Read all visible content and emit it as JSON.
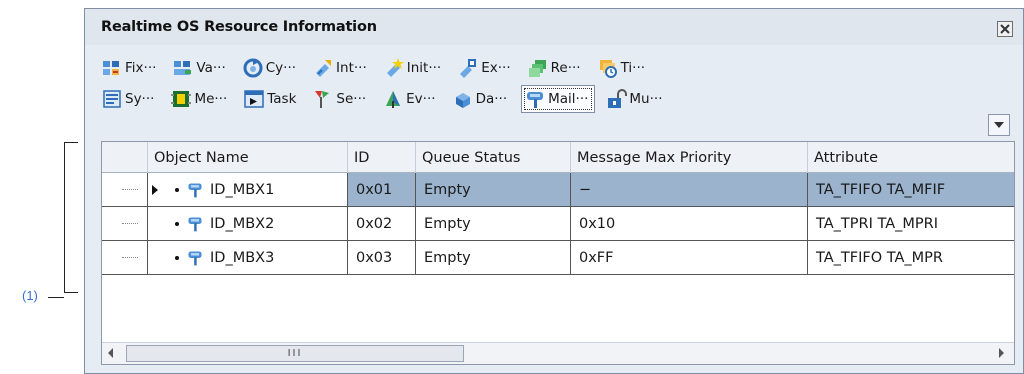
{
  "annotation": {
    "label": "(1)"
  },
  "window": {
    "title": "Realtime OS Resource Information"
  },
  "toolbar": {
    "row1": [
      {
        "label": "Fix···",
        "icon": "fixed-memory-icon"
      },
      {
        "label": "Va···",
        "icon": "variable-memory-icon"
      },
      {
        "label": "Cy···",
        "icon": "cyclic-handler-icon"
      },
      {
        "label": "Int···",
        "icon": "interrupt-handler-icon"
      },
      {
        "label": "Init···",
        "icon": "initialize-routine-icon"
      },
      {
        "label": "Ex···",
        "icon": "extended-svc-icon"
      },
      {
        "label": "Re···",
        "icon": "ready-queue-icon"
      },
      {
        "label": "Ti···",
        "icon": "timer-queue-icon"
      }
    ],
    "row2": [
      {
        "label": "Sy···",
        "icon": "system-icon"
      },
      {
        "label": "Me···",
        "icon": "memory-icon"
      },
      {
        "label": "Task",
        "icon": "task-icon"
      },
      {
        "label": "Se···",
        "icon": "semaphore-icon"
      },
      {
        "label": "Ev···",
        "icon": "eventflag-icon"
      },
      {
        "label": "Da···",
        "icon": "dataqueue-icon"
      },
      {
        "label": "Mail···",
        "icon": "mailbox-icon",
        "active": true
      },
      {
        "label": "Mu···",
        "icon": "mutex-icon"
      }
    ]
  },
  "table": {
    "columns": [
      "Object Name",
      "ID",
      "Queue Status",
      "Message Max Priority",
      "Attribute"
    ],
    "rows": [
      {
        "name": "ID_MBX1",
        "id": "0x01",
        "queue_status": "Empty",
        "max_priority": "−",
        "attribute": "TA_TFIFO TA_MFIF",
        "selected": true
      },
      {
        "name": "ID_MBX2",
        "id": "0x02",
        "queue_status": "Empty",
        "max_priority": "0x10",
        "attribute": "TA_TPRI TA_MPRI",
        "selected": false
      },
      {
        "name": "ID_MBX3",
        "id": "0x03",
        "queue_status": "Empty",
        "max_priority": "0xFF",
        "attribute": "TA_TFIFO TA_MPR",
        "selected": false
      }
    ]
  },
  "scrollbar": {
    "thumb_grip": "III"
  },
  "colors": {
    "selected_row": "#9bb3cc",
    "window_bg": "#e6ecf3",
    "annotation": "#3a6fc8"
  }
}
